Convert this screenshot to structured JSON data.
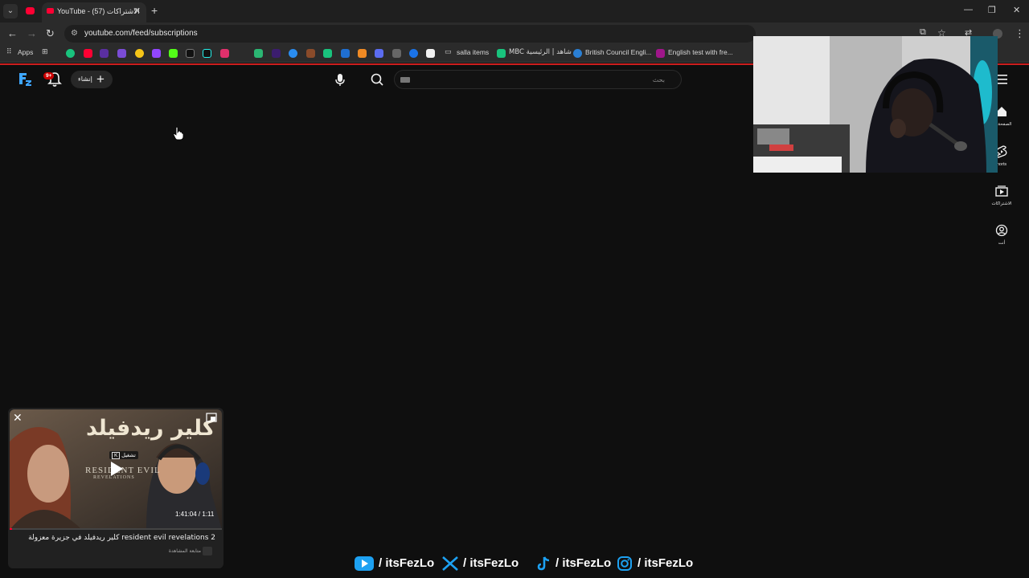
{
  "browser": {
    "tab_title": "YouTube - الاشتراكات (57)",
    "url": "youtube.com/feed/subscriptions",
    "bookmarks": [
      {
        "label": "Apps"
      },
      {
        "label": "salla items"
      },
      {
        "label": "MBC شاهد | الرئيسية"
      },
      {
        "label": "British Council Engli..."
      },
      {
        "label": "English test with fre..."
      }
    ]
  },
  "masthead": {
    "notification_count": "9+",
    "create_label": "إنشاء",
    "search_placeholder": "بحث"
  },
  "guide": {
    "items": [
      {
        "label": "الصفحة الر",
        "icon": "home-icon"
      },
      {
        "label": "horts",
        "icon": "shorts-icon"
      },
      {
        "label": "الاشتراكات",
        "icon": "subscriptions-icon"
      },
      {
        "label": "أنت",
        "icon": "you-icon"
      }
    ]
  },
  "miniplayer": {
    "thumb_title_ar": "كلير ريدفيلد",
    "thumb_logo": "RESIDENT EVIL",
    "thumb_logo_sub": "REVELATIONS",
    "tooltip_key": "K",
    "tooltip_label": "تشغيل",
    "time": "1:41:04 / 1:11",
    "title": "كلير ريدفيلد في جزيرة معزولة resident evil revelations 2",
    "subtitle": "متابعة المشاهدة"
  },
  "socials": [
    {
      "platform": "youtube-icon",
      "handle": "/ itsFezLo"
    },
    {
      "platform": "x-icon",
      "handle": "/ itsFezLo"
    },
    {
      "platform": "tiktok-icon",
      "handle": "/ itsFezLo"
    },
    {
      "platform": "instagram-icon",
      "handle": "/ itsFezLo"
    }
  ],
  "colors": {
    "background": "#0f0f0f",
    "accent_red": "#ff0033",
    "logo_blue": "#3ea6ff",
    "youtube_blue_social": "#1da1f2"
  }
}
